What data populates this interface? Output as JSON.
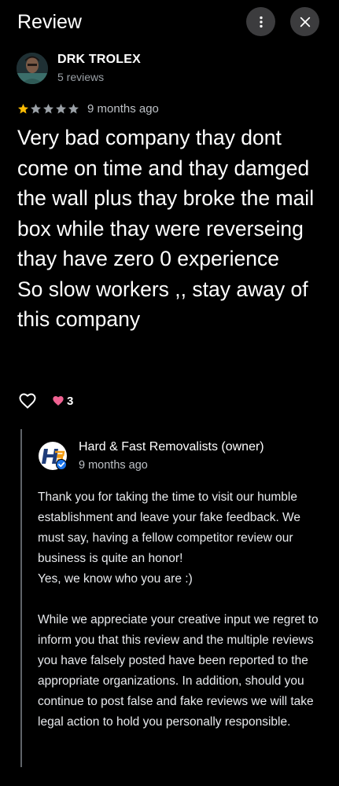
{
  "header": {
    "title": "Review",
    "more_icon": "more-vert-icon",
    "close_icon": "close-icon"
  },
  "review": {
    "author": "DRK TROLEX",
    "author_meta": "5 reviews",
    "rating": 1,
    "max_rating": 5,
    "time": "9 months ago",
    "text": "Very bad company thay dont come on time and thay damged the wall plus thay broke the mail box while thay were reverseing thay have zero 0 experience\nSo slow workers ,, stay away of this company",
    "reaction_count": "3"
  },
  "owner_reply": {
    "name": "Hard & Fast Removalists (owner)",
    "time": "9 months ago",
    "text": "Thank you for taking the time to visit our humble establishment and leave your fake feedback. We must say, having a fellow competitor review our business is quite an honor!\nYes, we know who you are :)\n\nWhile we appreciate your creative input we regret to inform you that this review and the multiple reviews you have falsely posted have been reported to the appropriate organizations. In addition, should you continue to post false and fake reviews we will take legal action to hold you personally responsible."
  },
  "colors": {
    "background": "#000000",
    "star_filled": "#fbbc04",
    "star_empty": "#9aa0a6",
    "heart_reaction": "#f06292",
    "button_bg": "#3c3c3e",
    "reply_border": "#5f6368",
    "owner_badge": "#1a73e8"
  }
}
